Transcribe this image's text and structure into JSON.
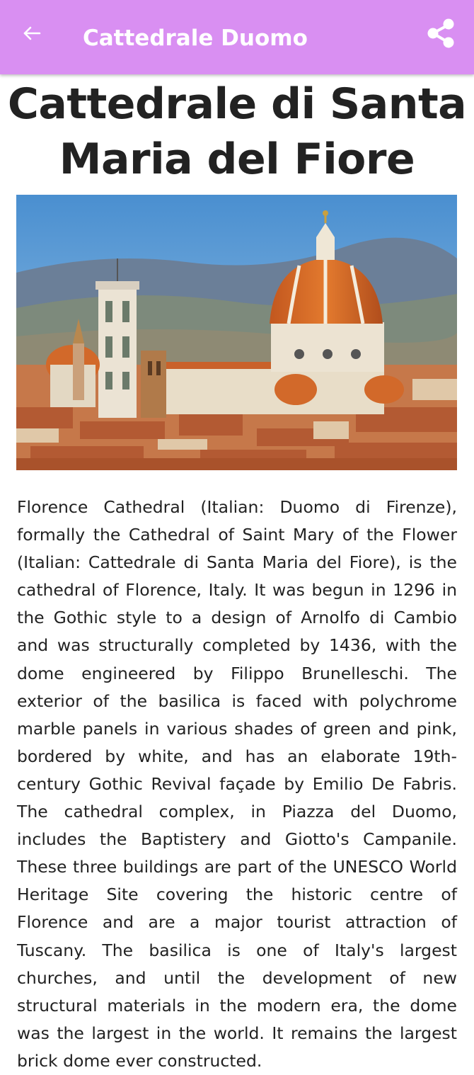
{
  "appbar": {
    "title": "Cattedrale Duomo",
    "background_color": "#d98ff2",
    "back_icon": "arrow-left-icon",
    "share_icon": "share-icon"
  },
  "main": {
    "title": "Cattedrale di Santa Maria del Fiore",
    "image_subject": "Florence Cathedral with dome and bell tower over city rooftops",
    "description": "Florence Cathedral (Italian: Duomo di Firenze), formally the Cathedral of Saint Mary of the Flower (Italian: Cattedrale di Santa Maria del Fiore), is the cathedral of Florence, Italy. It was begun in 1296 in the Gothic style to a design of Arnolfo di Cambio and was structurally completed by 1436, with the dome engineered by Filippo Brunelleschi. The exterior of the basilica is faced with polychrome marble panels in various shades of green and pink, bordered by white, and has an elaborate 19th-century Gothic Revival façade by Emilio De Fabris. The cathedral complex, in Piazza del Duomo, includes the Baptistery and Giotto's Campanile. These three buildings are part of the UNESCO World Heritage Site covering the historic centre of Florence and are a major tourist attraction of Tuscany. The basilica is one of Italy's largest churches, and until the development of new structural materials in the modern era, the dome was the largest in the world. It remains the largest brick dome ever constructed."
  }
}
